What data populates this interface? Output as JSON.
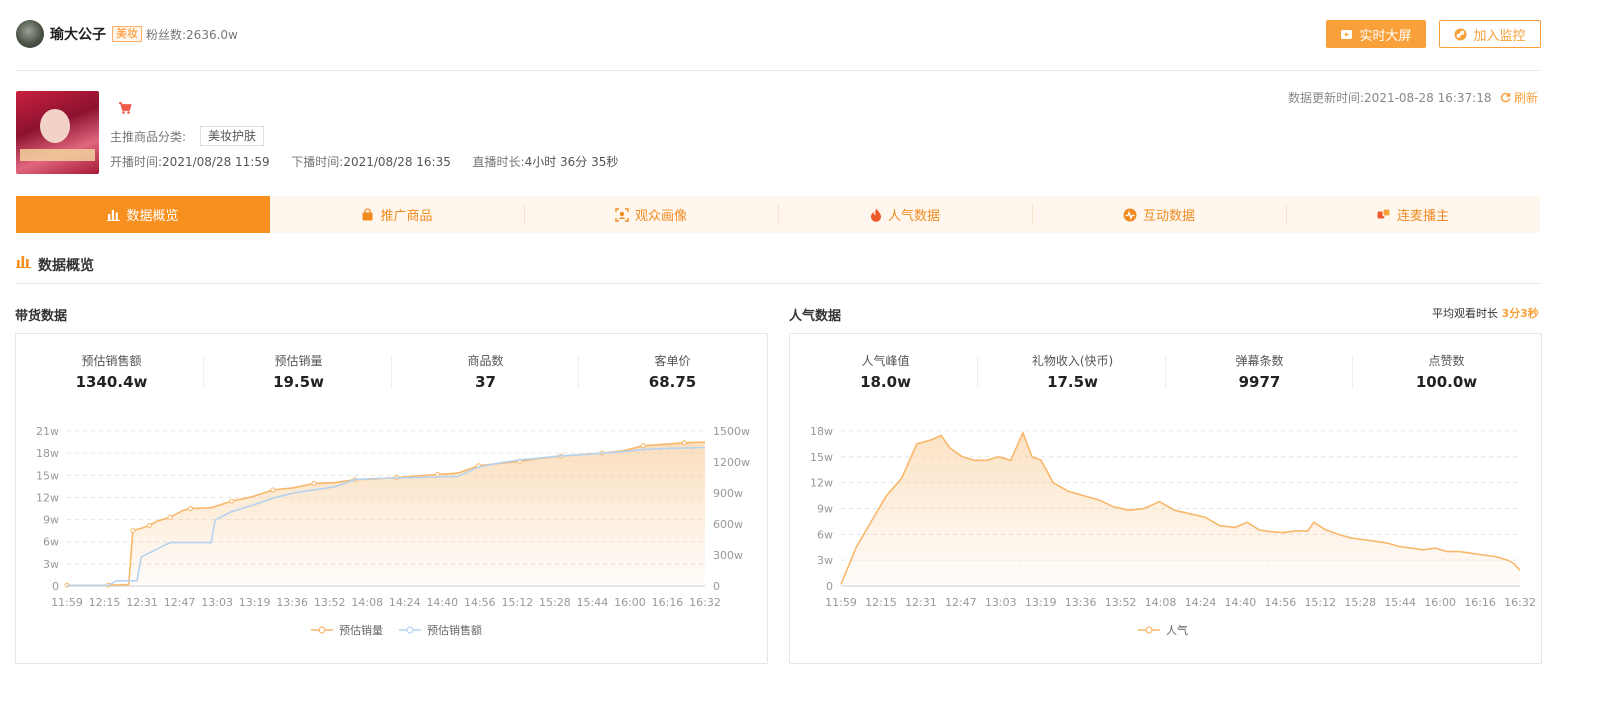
{
  "header": {
    "username": "瑜大公子",
    "category_badge": "美妆",
    "fans_label": "粉丝数:",
    "fans_value": "2636.0w",
    "live_screen_button": "实时大屏",
    "monitor_button": "加入监控"
  },
  "stream": {
    "category_label": "主推商品分类:",
    "category_tag": "美妆护肤",
    "start_label": "开播时间:",
    "start_time": "2021/08/28 11:59",
    "end_label": "下播时间:",
    "end_time": "2021/08/28 16:35",
    "duration_label": "直播时长:",
    "duration": "4小时 36分 35秒",
    "updated_label": "数据更新时间:",
    "updated_time": "2021-08-28 16:37:18",
    "refresh_label": "刷新"
  },
  "tabs": [
    {
      "label": "数据概览",
      "icon": "bar-chart-icon",
      "active": true
    },
    {
      "label": "推广商品",
      "icon": "shopping-bag-icon",
      "active": false
    },
    {
      "label": "观众画像",
      "icon": "face-scan-icon",
      "active": false
    },
    {
      "label": "人气数据",
      "icon": "fire-icon",
      "active": false
    },
    {
      "label": "互动数据",
      "icon": "pulse-icon",
      "active": false
    },
    {
      "label": "连麦播主",
      "icon": "link-squares-icon",
      "active": false
    }
  ],
  "overview": {
    "title": "数据概览"
  },
  "sales_panel": {
    "title": "带货数据",
    "stats": [
      {
        "label": "预估销售额",
        "value": "1340.4w"
      },
      {
        "label": "预估销量",
        "value": "19.5w"
      },
      {
        "label": "商品数",
        "value": "37"
      },
      {
        "label": "客单价",
        "value": "68.75"
      }
    ]
  },
  "popularity_panel": {
    "title": "人气数据",
    "avg_watch_label": "平均观看时长",
    "avg_watch_value": "3分3秒",
    "stats": [
      {
        "label": "人气峰值",
        "value": "18.0w"
      },
      {
        "label": "礼物收入(快币)",
        "value": "17.5w"
      },
      {
        "label": "弹幕条数",
        "value": "9977"
      },
      {
        "label": "点赞数",
        "value": "100.0w"
      }
    ]
  },
  "colors": {
    "accent": "#f8a13a",
    "tab_active": "#f8901f",
    "tab_bg": "#fff7ee",
    "series_orange": "#f8b76a",
    "series_blue": "#b5d3f0"
  },
  "chart_data": [
    {
      "type": "area",
      "x_ticks": [
        "11:59",
        "12:15",
        "12:31",
        "12:47",
        "13:03",
        "13:19",
        "13:36",
        "13:52",
        "14:08",
        "14:24",
        "14:40",
        "14:56",
        "15:12",
        "15:28",
        "15:44",
        "16:00",
        "16:16",
        "16:32"
      ],
      "y_left_ticks": [
        "0",
        "3w",
        "6w",
        "9w",
        "12w",
        "15w",
        "18w",
        "21w"
      ],
      "y_left_lim": [
        0,
        21
      ],
      "y_right_ticks": [
        "0",
        "300w",
        "600w",
        "900w",
        "1200w",
        "1500w"
      ],
      "y_right_lim": [
        0,
        1500
      ],
      "grid": true,
      "legend": "bottom",
      "series": [
        {
          "name": "预估销量",
          "axis": "left",
          "unit": "w",
          "points": [
            [
              0,
              0.1
            ],
            [
              1,
              0.1
            ],
            [
              2,
              0.1
            ],
            [
              3,
              0.2
            ],
            [
              3.2,
              7.5
            ],
            [
              3.6,
              7.8
            ],
            [
              4,
              8.2
            ],
            [
              4.4,
              8.8
            ],
            [
              5,
              9.3
            ],
            [
              5.6,
              10.2
            ],
            [
              6,
              10.5
            ],
            [
              7,
              10.6
            ],
            [
              8,
              11.5
            ],
            [
              9,
              12.1
            ],
            [
              10,
              13.0
            ],
            [
              11,
              13.3
            ],
            [
              12,
              13.9
            ],
            [
              13,
              14.0
            ],
            [
              14,
              14.4
            ],
            [
              15,
              14.5
            ],
            [
              16,
              14.7
            ],
            [
              17,
              14.9
            ],
            [
              18,
              15.1
            ],
            [
              19,
              15.3
            ],
            [
              20,
              16.3
            ],
            [
              21,
              16.6
            ],
            [
              22,
              16.9
            ],
            [
              23,
              17.3
            ],
            [
              24,
              17.6
            ],
            [
              25,
              17.8
            ],
            [
              26,
              18.0
            ],
            [
              27,
              18.3
            ],
            [
              28,
              19.0
            ],
            [
              29,
              19.2
            ],
            [
              30,
              19.4
            ],
            [
              31,
              19.5
            ]
          ]
        },
        {
          "name": "预估销售额",
          "axis": "right",
          "unit": "w",
          "points": [
            [
              0,
              5
            ],
            [
              1,
              5
            ],
            [
              2,
              5
            ],
            [
              2.4,
              50
            ],
            [
              3.4,
              50
            ],
            [
              3.6,
              280
            ],
            [
              4,
              320
            ],
            [
              4.4,
              360
            ],
            [
              5,
              420
            ],
            [
              6,
              420
            ],
            [
              7,
              420
            ],
            [
              7.2,
              640
            ],
            [
              8,
              720
            ],
            [
              9,
              780
            ],
            [
              10,
              850
            ],
            [
              11,
              900
            ],
            [
              12,
              930
            ],
            [
              13,
              960
            ],
            [
              14,
              1030
            ],
            [
              15,
              1040
            ],
            [
              16,
              1045
            ],
            [
              17,
              1050
            ],
            [
              18,
              1055
            ],
            [
              19,
              1060
            ],
            [
              20,
              1150
            ],
            [
              21,
              1190
            ],
            [
              22,
              1220
            ],
            [
              23,
              1240
            ],
            [
              24,
              1260
            ],
            [
              25,
              1270
            ],
            [
              26,
              1285
            ],
            [
              27,
              1300
            ],
            [
              28,
              1320
            ],
            [
              29,
              1330
            ],
            [
              30,
              1335
            ],
            [
              31,
              1340
            ]
          ]
        }
      ]
    },
    {
      "type": "area",
      "x_ticks": [
        "11:59",
        "12:15",
        "12:31",
        "12:47",
        "13:03",
        "13:19",
        "13:36",
        "13:52",
        "14:08",
        "14:24",
        "14:40",
        "14:56",
        "15:12",
        "15:28",
        "15:44",
        "16:00",
        "16:16",
        "16:32"
      ],
      "y_ticks": [
        "0",
        "3w",
        "6w",
        "9w",
        "12w",
        "15w",
        "18w"
      ],
      "ylim": [
        0,
        18
      ],
      "grid": true,
      "legend": "bottom",
      "series": [
        {
          "name": "人气",
          "unit": "w",
          "points": [
            [
              0,
              0.2
            ],
            [
              0.5,
              4.5
            ],
            [
              1,
              7.5
            ],
            [
              1.5,
              10.5
            ],
            [
              2,
              12.5
            ],
            [
              2.5,
              16.5
            ],
            [
              3,
              17.0
            ],
            [
              3.3,
              17.5
            ],
            [
              3.6,
              16.0
            ],
            [
              4,
              15.0
            ],
            [
              4.4,
              14.6
            ],
            [
              4.8,
              14.6
            ],
            [
              5.2,
              15.0
            ],
            [
              5.6,
              14.6
            ],
            [
              6,
              17.8
            ],
            [
              6.3,
              15.0
            ],
            [
              6.6,
              14.6
            ],
            [
              7,
              12.0
            ],
            [
              7.5,
              11.0
            ],
            [
              8,
              10.5
            ],
            [
              8.5,
              10.0
            ],
            [
              9,
              9.2
            ],
            [
              9.5,
              8.8
            ],
            [
              10,
              9.0
            ],
            [
              10.5,
              9.8
            ],
            [
              11,
              8.8
            ],
            [
              11.5,
              8.4
            ],
            [
              12,
              8.0
            ],
            [
              12.5,
              7.0
            ],
            [
              13,
              6.8
            ],
            [
              13.4,
              7.4
            ],
            [
              13.8,
              6.5
            ],
            [
              14.2,
              6.3
            ],
            [
              14.6,
              6.2
            ],
            [
              15,
              6.4
            ],
            [
              15.4,
              6.4
            ],
            [
              15.6,
              7.4
            ],
            [
              16,
              6.5
            ],
            [
              16.4,
              6.0
            ],
            [
              16.8,
              5.6
            ],
            [
              17.2,
              5.4
            ],
            [
              17.6,
              5.2
            ],
            [
              18,
              5.0
            ],
            [
              18.4,
              4.6
            ],
            [
              18.8,
              4.4
            ],
            [
              19.2,
              4.2
            ],
            [
              19.6,
              4.4
            ],
            [
              20,
              4.0
            ],
            [
              20.4,
              4.0
            ],
            [
              20.8,
              3.8
            ],
            [
              21.2,
              3.6
            ],
            [
              21.6,
              3.4
            ],
            [
              22,
              3.0
            ],
            [
              22.2,
              2.6
            ],
            [
              22.4,
              1.8
            ]
          ]
        }
      ]
    }
  ]
}
